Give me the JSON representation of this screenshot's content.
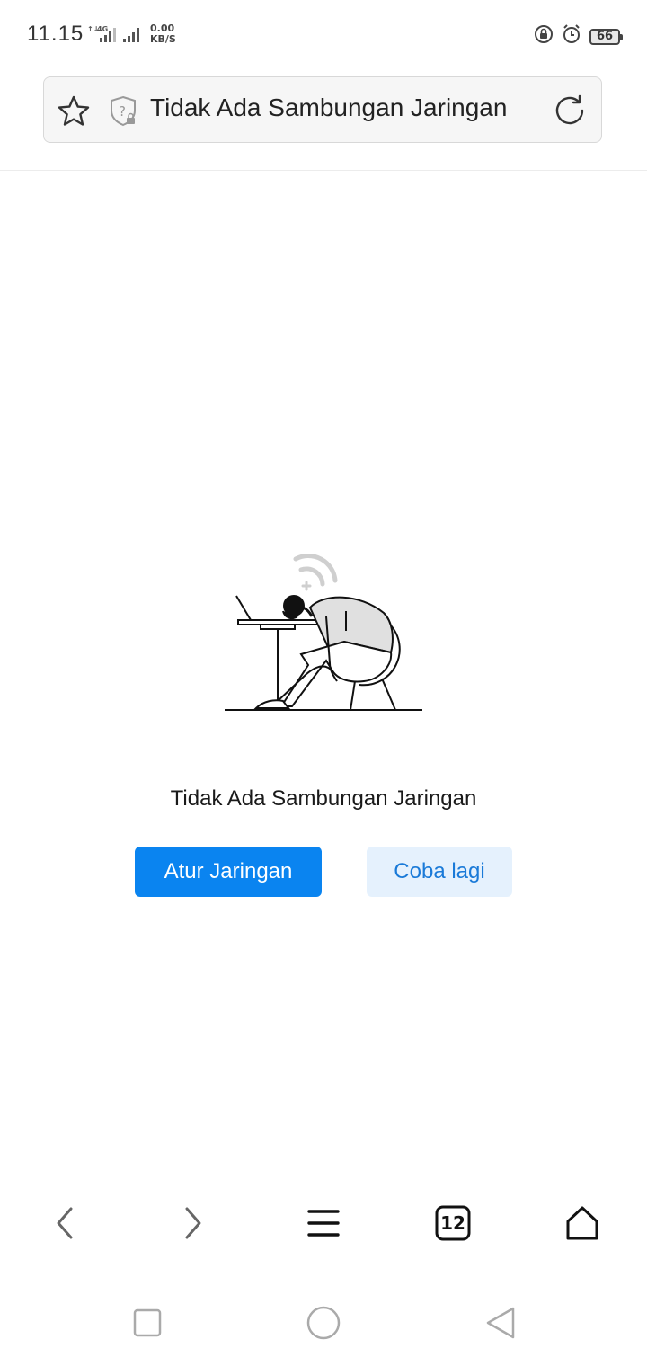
{
  "status_bar": {
    "time": "11.15",
    "network_type": "4G",
    "speed_value": "0.00",
    "speed_unit": "KB/S",
    "battery_level": "66"
  },
  "address_bar": {
    "title": "Tidak Ada Sambungan Jaringan",
    "icons": [
      "star-icon",
      "shield-unknown-icon",
      "reload-icon"
    ]
  },
  "error_page": {
    "message": "Tidak Ada Sambungan Jaringan",
    "primary_button_label": "Atur Jaringan",
    "secondary_button_label": "Coba lagi"
  },
  "toolbar": {
    "items": [
      "back-icon",
      "forward-icon",
      "menu-icon",
      "tabs-icon",
      "home-icon"
    ],
    "tab_count": "12"
  },
  "system_nav": {
    "items": [
      "recent-apps-icon",
      "home-circle-icon",
      "back-triangle-icon"
    ]
  },
  "colors": {
    "accent": "#0a84f0",
    "secondary_bg": "#e5f1fd",
    "secondary_text": "#1a7ad8"
  }
}
